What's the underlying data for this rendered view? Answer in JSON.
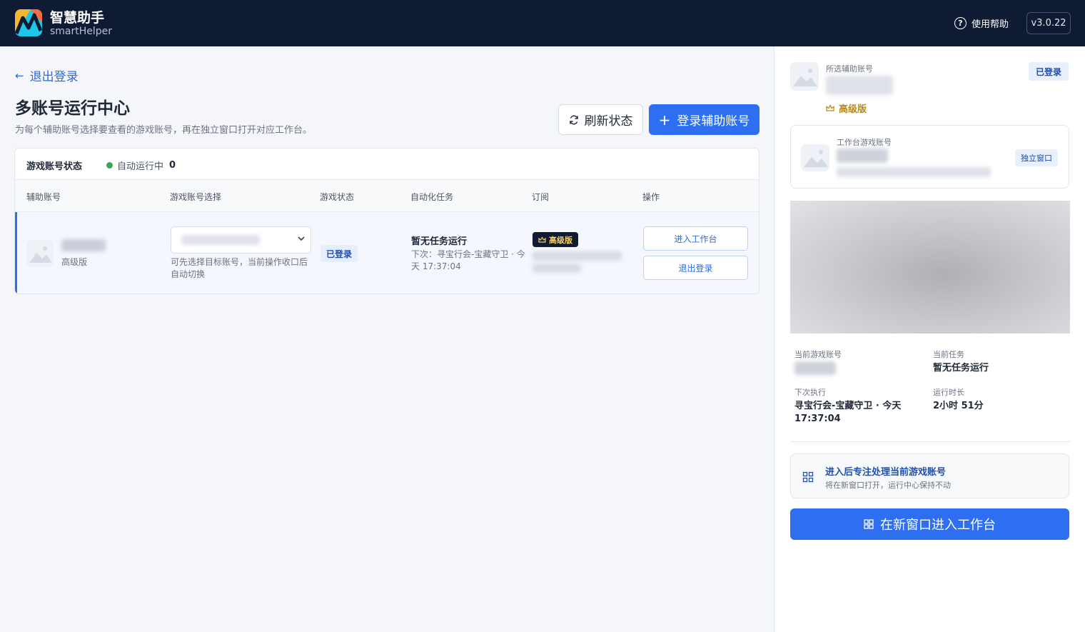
{
  "app": {
    "title": "智慧助手",
    "subtitle": "smartHelper",
    "help_label": "使用帮助",
    "version": "v3.0.22"
  },
  "main": {
    "back_label": "退出登录",
    "page_title": "多账号运行中心",
    "page_desc": "为每个辅助账号选择要查看的游戏账号，再在独立窗口打开对应工作台。",
    "refresh_label": "刷新状态",
    "login_label": "登录辅助账号"
  },
  "table": {
    "status_title": "游戏账号状态",
    "auto_label": "自动运行中",
    "auto_count": "0",
    "columns": [
      "辅助账号",
      "游戏账号选择",
      "游戏状态",
      "自动化任务",
      "订阅",
      "操作"
    ],
    "rows": [
      {
        "tier": "高级版",
        "select_hint": "可先选择目标账号，当前操作收口后自动切换",
        "game_status": "已登录",
        "task_title": "暂无任务运行",
        "task_next": "下次：寻宝行会-宝藏守卫 · 今天 17:37:04",
        "subscription": "高级版",
        "actions": [
          "进入工作台",
          "退出登录"
        ]
      }
    ]
  },
  "side": {
    "selected_label": "所选辅助账号",
    "selected_tier": "高级版",
    "logged_in": "已登录",
    "workspace_label": "工作台游戏账号",
    "window_btn": "独立窗口",
    "current_game_label": "当前游戏账号",
    "current_task_label": "当前任务",
    "current_task_value": "暂无任务运行",
    "next_exec_label": "下次执行",
    "next_exec_value": "寻宝行会-宝藏守卫 · 今天 17:37:04",
    "runtime_label": "运行时长",
    "runtime_value": "2小时 51分",
    "focus_title": "进入后专注处理当前游戏账号",
    "focus_sub": "将在新窗口打开，运行中心保持不动",
    "enter_label": "在新窗口进入工作台"
  },
  "colors": {
    "header_bg": "#0f1b33",
    "accent": "#2e6ff2",
    "status_green": "#34a853",
    "vip_gold": "#b7881a"
  },
  "icons": [
    "app-logo",
    "help-icon",
    "arrow-left-icon",
    "refresh-icon",
    "plus-icon",
    "chevron-down-icon",
    "crown-icon",
    "image-placeholder-icon",
    "grid-icon"
  ]
}
